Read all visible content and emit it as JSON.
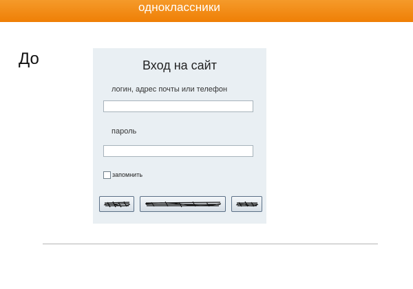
{
  "header": {
    "brand": "одноклассники",
    "color": "#f08a10"
  },
  "side_label": "До",
  "login": {
    "title": "Вход на сайт",
    "login_label": "логин, адрес почты или телефон",
    "login_value": "",
    "password_label": "пароль",
    "password_value": "",
    "remember_label": "запомнить",
    "remember_checked": false,
    "buttons": [
      {
        "label": "",
        "state": "scribbled-out"
      },
      {
        "label": "",
        "state": "scribbled-out"
      },
      {
        "label": "",
        "state": "scribbled-out"
      }
    ]
  }
}
